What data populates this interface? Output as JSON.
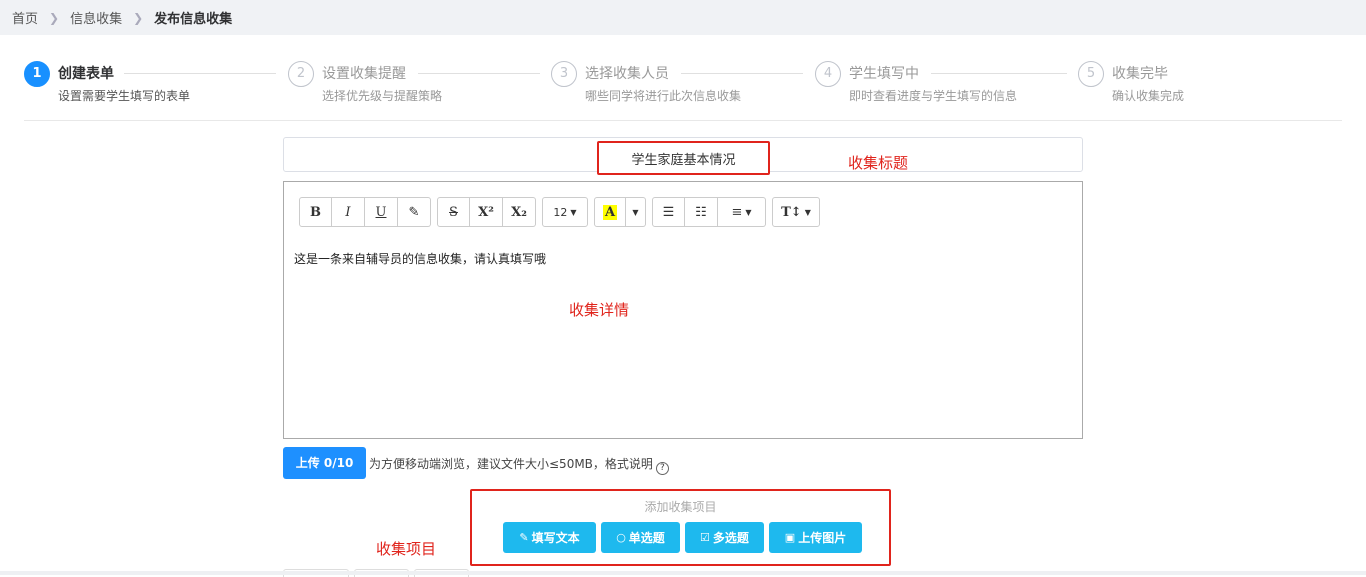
{
  "breadcrumb": [
    "首页",
    "信息收集",
    "发布信息收集"
  ],
  "steps": [
    {
      "num": "1",
      "title": "创建表单",
      "desc": "设置需要学生填写的表单",
      "active": true
    },
    {
      "num": "2",
      "title": "设置收集提醒",
      "desc": "选择优先级与提醒策略",
      "active": false
    },
    {
      "num": "3",
      "title": "选择收集人员",
      "desc": "哪些同学将进行此次信息收集",
      "active": false
    },
    {
      "num": "4",
      "title": "学生填写中",
      "desc": "即时查看进度与学生填写的信息",
      "active": false
    },
    {
      "num": "5",
      "title": "收集完毕",
      "desc": "确认收集完成",
      "active": false
    }
  ],
  "form": {
    "title_value": "学生家庭基本情况",
    "annot_title": "收集标题",
    "annot_detail": "收集详情",
    "annot_items": "收集项目",
    "editor_content": "这是一条来自辅导员的信息收集，请认真填写哦"
  },
  "toolbar": {
    "bold": "B",
    "italic": "I",
    "underline": "U",
    "eraser": "✎",
    "strike": "S",
    "sup": "X²",
    "sub": "X₂",
    "font_size": "12",
    "color": "A",
    "ul": "☰",
    "ol": "☷",
    "align": "≡",
    "height": "T↕"
  },
  "upload": {
    "label": "上传 0/10",
    "hint": "为方便移动端浏览，建议文件大小≤50MB，格式说明"
  },
  "items": {
    "label": "添加收集项目",
    "buttons": [
      {
        "icon": "✎",
        "label": "填写文本"
      },
      {
        "icon": "○",
        "label": "单选题"
      },
      {
        "icon": "☑",
        "label": "多选题"
      },
      {
        "icon": "▣",
        "label": "上传图片"
      }
    ]
  },
  "colors": {
    "primary": "#1890ff",
    "annotation": "#e0241c",
    "item_button": "#1eb9ee"
  }
}
